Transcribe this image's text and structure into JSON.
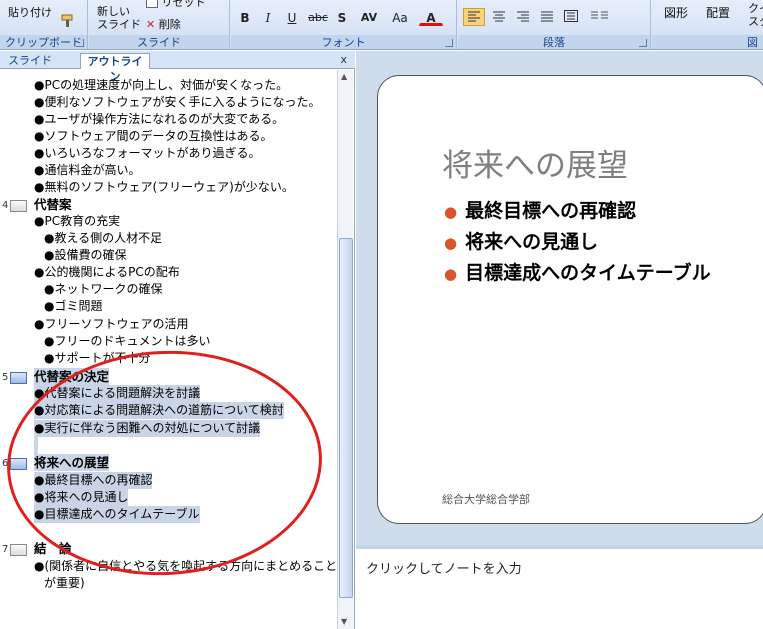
{
  "ribbon": {
    "clipboard": {
      "paste_label": "貼り付け",
      "group_label": "クリップボード"
    },
    "slides": {
      "new_slide_label_1": "新しい",
      "new_slide_label_2": "スライド",
      "reset_label": "リセット",
      "delete_label": "削除",
      "group_label": "スライド"
    },
    "font": {
      "bold": "B",
      "italic": "I",
      "underline": "U",
      "strike": "abc",
      "shadow": "S",
      "spacing": "AV",
      "case": "Aa",
      "color": "A",
      "group_label": "フォント"
    },
    "paragraph": {
      "group_label": "段落"
    },
    "drawing": {
      "shapes_label": "図形",
      "arrange_label": "配置",
      "quick_styles_label_1": "クイ",
      "quick_styles_label_2": "スタ",
      "group_label": "図"
    }
  },
  "panel": {
    "tabs": [
      "スライド",
      "アウトライン"
    ],
    "active_tab": "アウトライン",
    "close": "x"
  },
  "outline": {
    "top_items": [
      "●PCの処理速度が向上し、対価が安くなった。",
      "●便利なソフトウェアが安く手に入るようになった。",
      "●ユーザが操作方法になれるのが大変である。",
      "●ソフトウェア間のデータの互換性はある。",
      "●いろいろなフォーマットがあり過ぎる。",
      "●通信料金が高い。",
      "●無料のソフトウェア(フリーウェア)が少ない。"
    ],
    "slide4": {
      "number": "4",
      "title": "代替案",
      "lines": [
        "●PC教育の充実",
        "●教える側の人材不足",
        "●設備費の確保",
        "●公的機関によるPCの配布",
        "●ネットワークの確保",
        "●ゴミ問題",
        "●フリーソフトウェアの活用",
        "●フリーのドキュメントは多い",
        "●サポートが不十分"
      ]
    },
    "slide5": {
      "number": "5",
      "title": "代替案の決定",
      "lines": [
        "●代替案による問題解決を討議",
        "●対応策による問題解決への道筋について検討",
        "●実行に伴なう困難への対処について討議"
      ]
    },
    "slide6": {
      "number": "6",
      "title": "将来への展望",
      "lines": [
        "●最終目標への再確認",
        "●将来への見通し",
        "●目標達成へのタイムテーブル"
      ]
    },
    "slide7": {
      "number": "7",
      "title": "結　論",
      "lines": [
        "●(関係者に自信とやる気を喚起する方向にまとめること",
        "が重要)"
      ]
    }
  },
  "slide": {
    "title": "将来への展望",
    "bullets": [
      "最終目標への再確認",
      "将来への見通し",
      "目標達成へのタイムテーブル"
    ],
    "bullet_glyph": "●",
    "footer": "総合大学総合学部",
    "bullet_color": "#d8542a"
  },
  "notes": {
    "placeholder": "クリックしてノートを入力"
  },
  "colors": {
    "annotation_circle": "#e02020",
    "selection": "#c9d5e6",
    "ribbon": "#d0def3"
  }
}
